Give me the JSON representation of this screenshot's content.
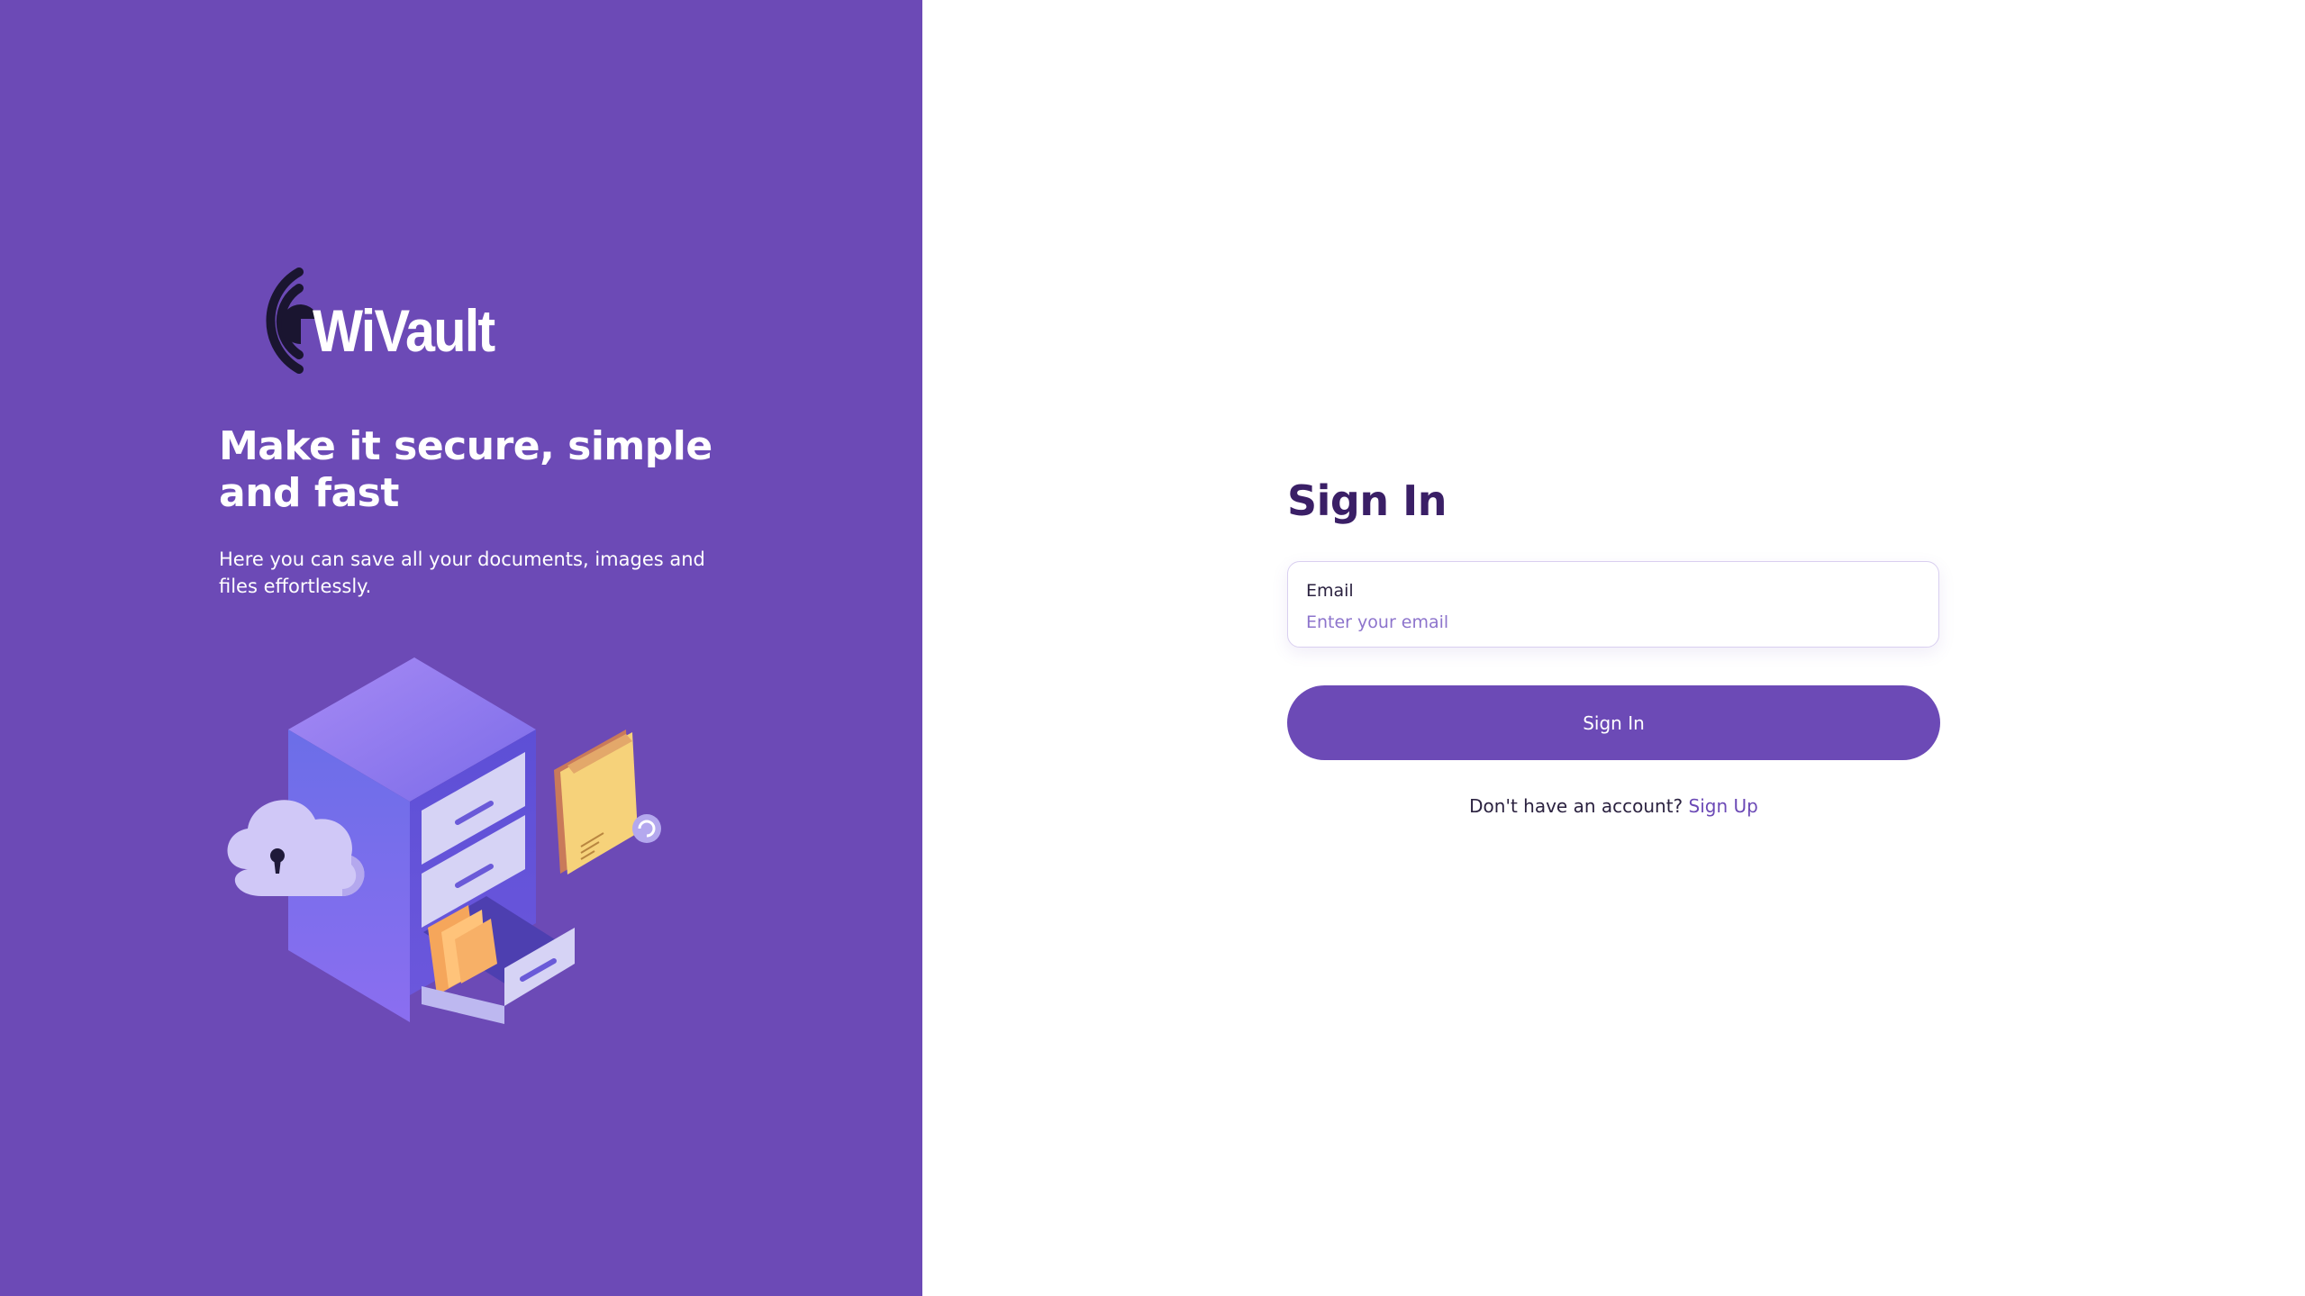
{
  "brand": {
    "name": "WiVault",
    "panel_color": "#6c4ab6"
  },
  "hero": {
    "tagline": "Make it secure, simple and fast",
    "description": "Here you can save all your documents, images and files effortlessly."
  },
  "signin": {
    "title": "Sign In",
    "email_label": "Email",
    "email_placeholder": "Enter your email",
    "email_value": "",
    "button_label": "Sign In",
    "signup_prompt": "Don't have an account?",
    "signup_link": "Sign Up"
  },
  "colors": {
    "accent": "#6c4ab6",
    "title": "#3a1f66",
    "placeholder": "#8d74cc"
  },
  "icons": {
    "logo": "wivault-logo-icon",
    "illustration": "file-cabinet-cloud-illustration"
  }
}
